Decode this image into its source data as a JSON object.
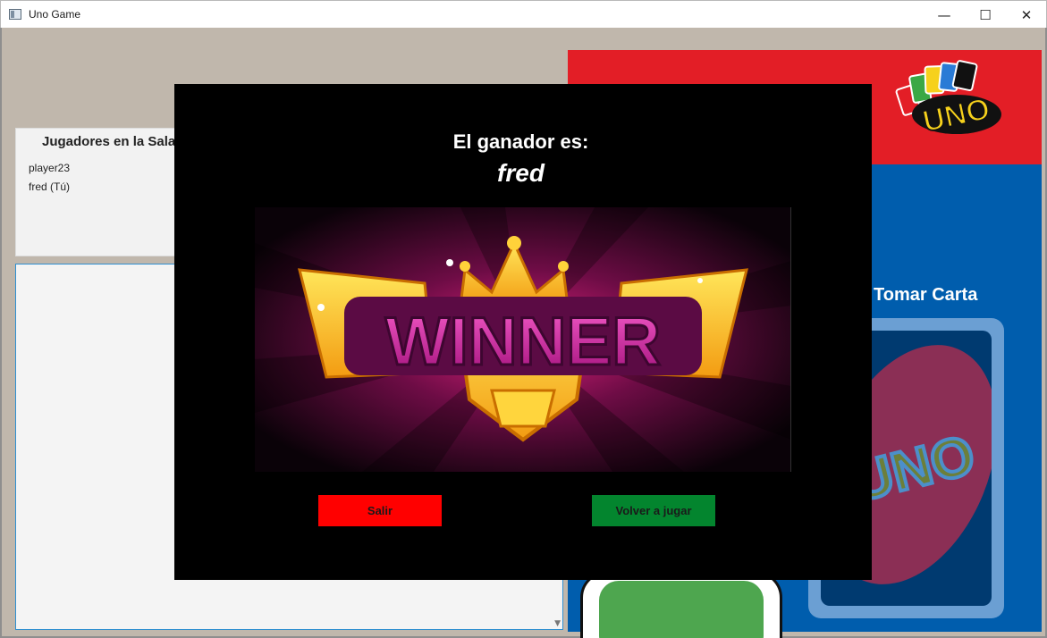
{
  "window": {
    "title": "Uno Game",
    "minimize_glyph": "—",
    "maximize_glyph": "☐",
    "close_glyph": "✕"
  },
  "players": {
    "title": "Jugadores en la Sala",
    "list": [
      "player23",
      "fred (Tú)"
    ]
  },
  "game": {
    "take_card_label": "Tomar Carta",
    "logo_text": "UNO",
    "deck_text": "UNO"
  },
  "winner_dialog": {
    "label": "El ganador es:",
    "name": "fred",
    "banner_text": "WINNER",
    "exit_label": "Salir",
    "play_again_label": "Volver a jugar"
  },
  "colors": {
    "exit_button": "#ff0000",
    "play_again_button": "#03852e",
    "game_blue": "#005dad",
    "game_red": "#e31e26"
  }
}
